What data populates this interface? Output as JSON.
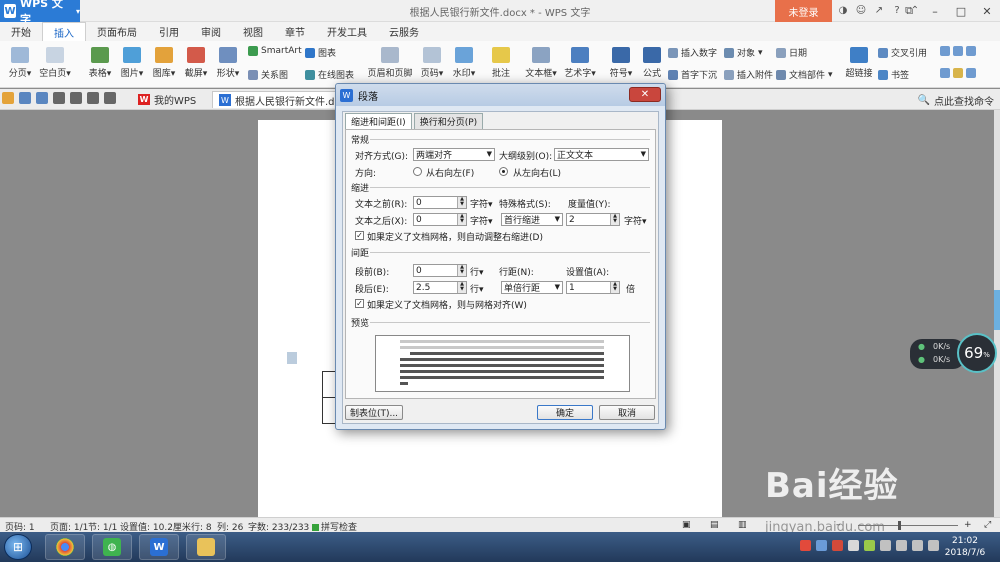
{
  "app": {
    "name": "WPS 文字",
    "window_title": "根据人民银行新文件.docx * - WPS 文字",
    "login_label": "未登录"
  },
  "tabs": [
    "开始",
    "插入",
    "页面布局",
    "引用",
    "审阅",
    "视图",
    "章节",
    "开发工具",
    "云服务"
  ],
  "active_tab": "插入",
  "ribbon": {
    "items": [
      "分页",
      "空白页",
      "表格",
      "图片",
      "图库",
      "截屏",
      "形状",
      "关系图",
      "在线图表",
      "页眉和页脚",
      "页码",
      "水印",
      "批注",
      "文本框",
      "艺术字",
      "符号",
      "公式",
      "首字下沉",
      "插入附件",
      "文档部件",
      "超链接",
      "书签"
    ],
    "small": {
      "smartart": "SmartArt",
      "chart": "图表",
      "insert_number": "插入数字",
      "object": "对象",
      "date": "日期",
      "cross_ref": "交叉引用"
    }
  },
  "doc_tabs": {
    "my_wps": "我的WPS",
    "file": "根据人民银行新文件.docx",
    "search_cmd": "点此查找命令"
  },
  "dialog": {
    "title": "段落",
    "tab_indent": "缩进和间距(I)",
    "tab_linebreak": "换行和分页(P)",
    "sec_general": "常规",
    "align_label": "对齐方式(G):",
    "align_value": "两端对齐",
    "outline_label": "大纲级别(O):",
    "outline_value": "正文文本",
    "direction_label": "方向:",
    "rtl_label": "从右向左(F)",
    "ltr_label": "从左向右(L)",
    "sec_indent": "缩进",
    "before_text_label": "文本之前(R):",
    "before_text_value": "0",
    "after_text_label": "文本之后(X):",
    "after_text_value": "0",
    "unit_char": "字符▾",
    "special_label": "特殊格式(S):",
    "special_value": "首行缩进",
    "measure_label": "度量值(Y):",
    "measure_value": "2",
    "auto_indent_label": "如果定义了文档网格，则自动调整右缩进(D)",
    "sec_spacing": "间距",
    "space_before_label": "段前(B):",
    "space_before_value": "0",
    "space_after_label": "段后(E):",
    "space_after_value": "2.5",
    "unit_line": "行▾",
    "line_spacing_label": "行距(N):",
    "line_spacing_value": "单倍行距",
    "setting_label": "设置值(A):",
    "setting_value": "1",
    "unit_times": "倍",
    "grid_align_label": "如果定义了文档网格，则与网格对齐(W)",
    "sec_preview": "预览",
    "tabs_button": "制表位(T)...",
    "ok_button": "确定",
    "cancel_button": "取消"
  },
  "network": {
    "up": "0K/s",
    "down": "0K/s",
    "percent": "69",
    "unit": "%"
  },
  "status": {
    "page": "页码: 1",
    "pages": "页面: 1/1",
    "section": "节: 1/1",
    "setting": "设置值: 10.2厘米",
    "row": "行: 8",
    "col": "列: 26",
    "words": "字数: 233/233",
    "spell": "拼写检查"
  },
  "clock": {
    "time": "21:02",
    "date": "2018/7/6"
  },
  "watermark": {
    "text": "Bai经验",
    "url": "jingyan.baidu.com"
  },
  "colors": {
    "accent": "#2b7bd6",
    "login": "#e8704a",
    "close": "#c9463d"
  }
}
